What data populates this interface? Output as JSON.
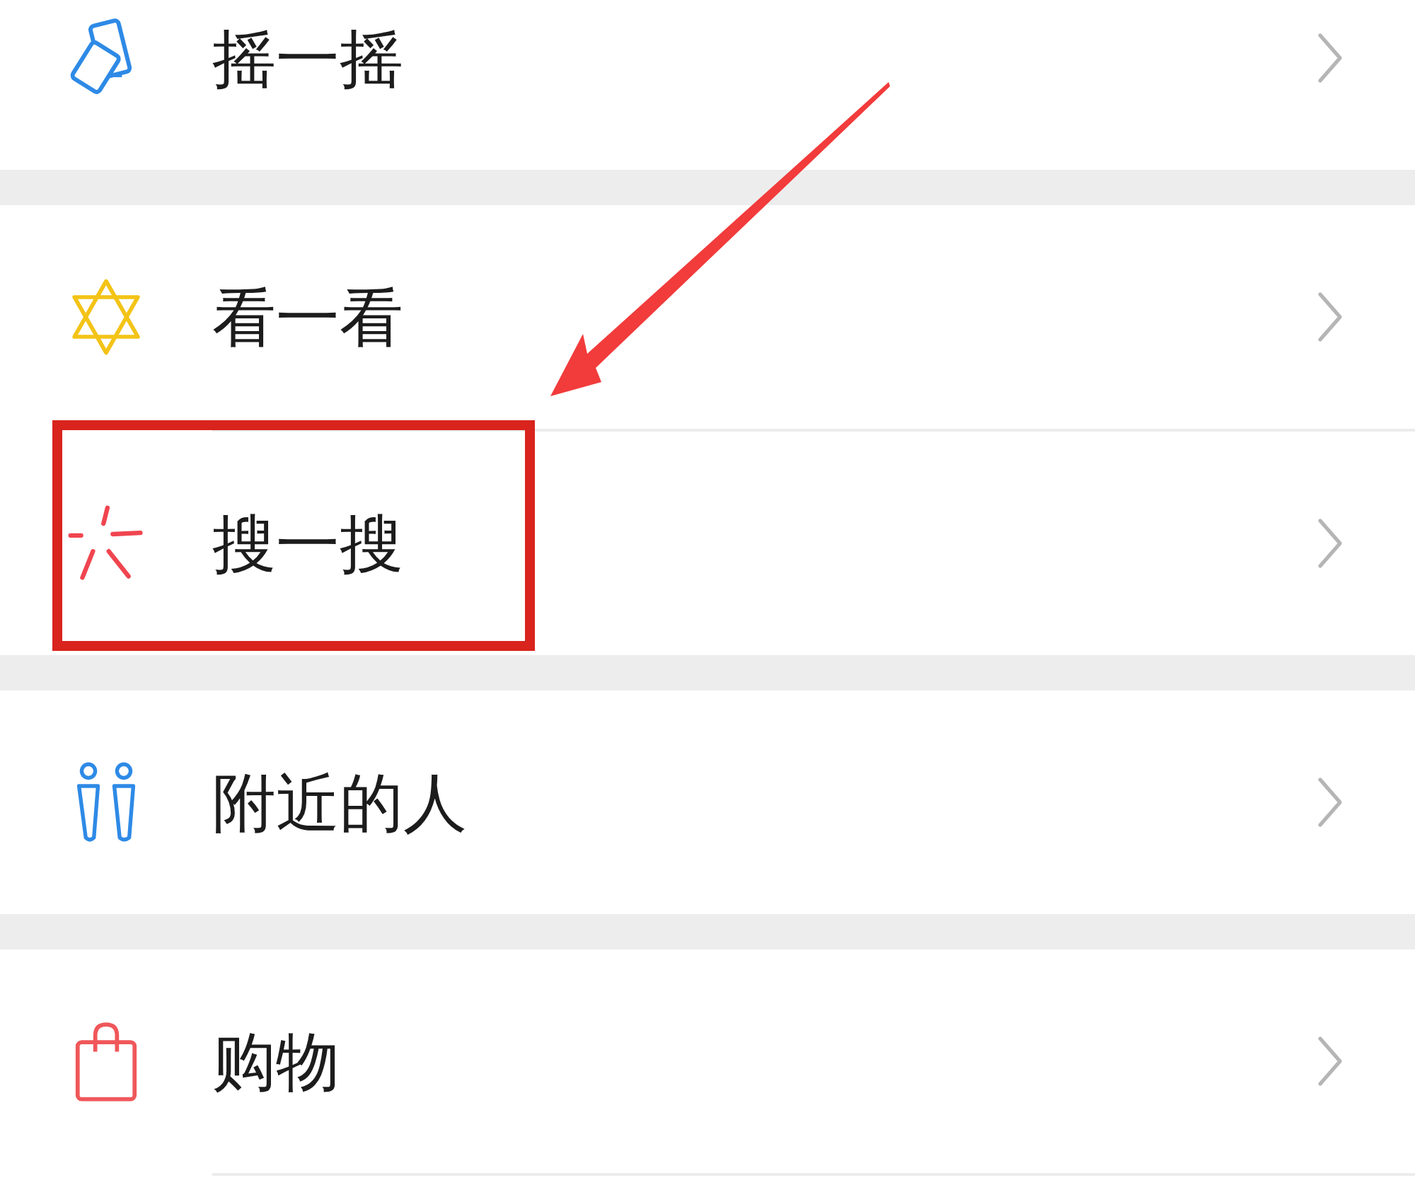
{
  "groups": [
    {
      "items": [
        {
          "label": "摇一摇",
          "highlighted": false
        }
      ]
    },
    {
      "items": [
        {
          "label": "看一看",
          "highlighted": false
        },
        {
          "label": "搜一搜",
          "highlighted": true
        }
      ]
    },
    {
      "items": [
        {
          "label": "附近的人",
          "highlighted": false
        }
      ]
    },
    {
      "items": [
        {
          "label": "购物",
          "highlighted": false
        }
      ]
    }
  ]
}
